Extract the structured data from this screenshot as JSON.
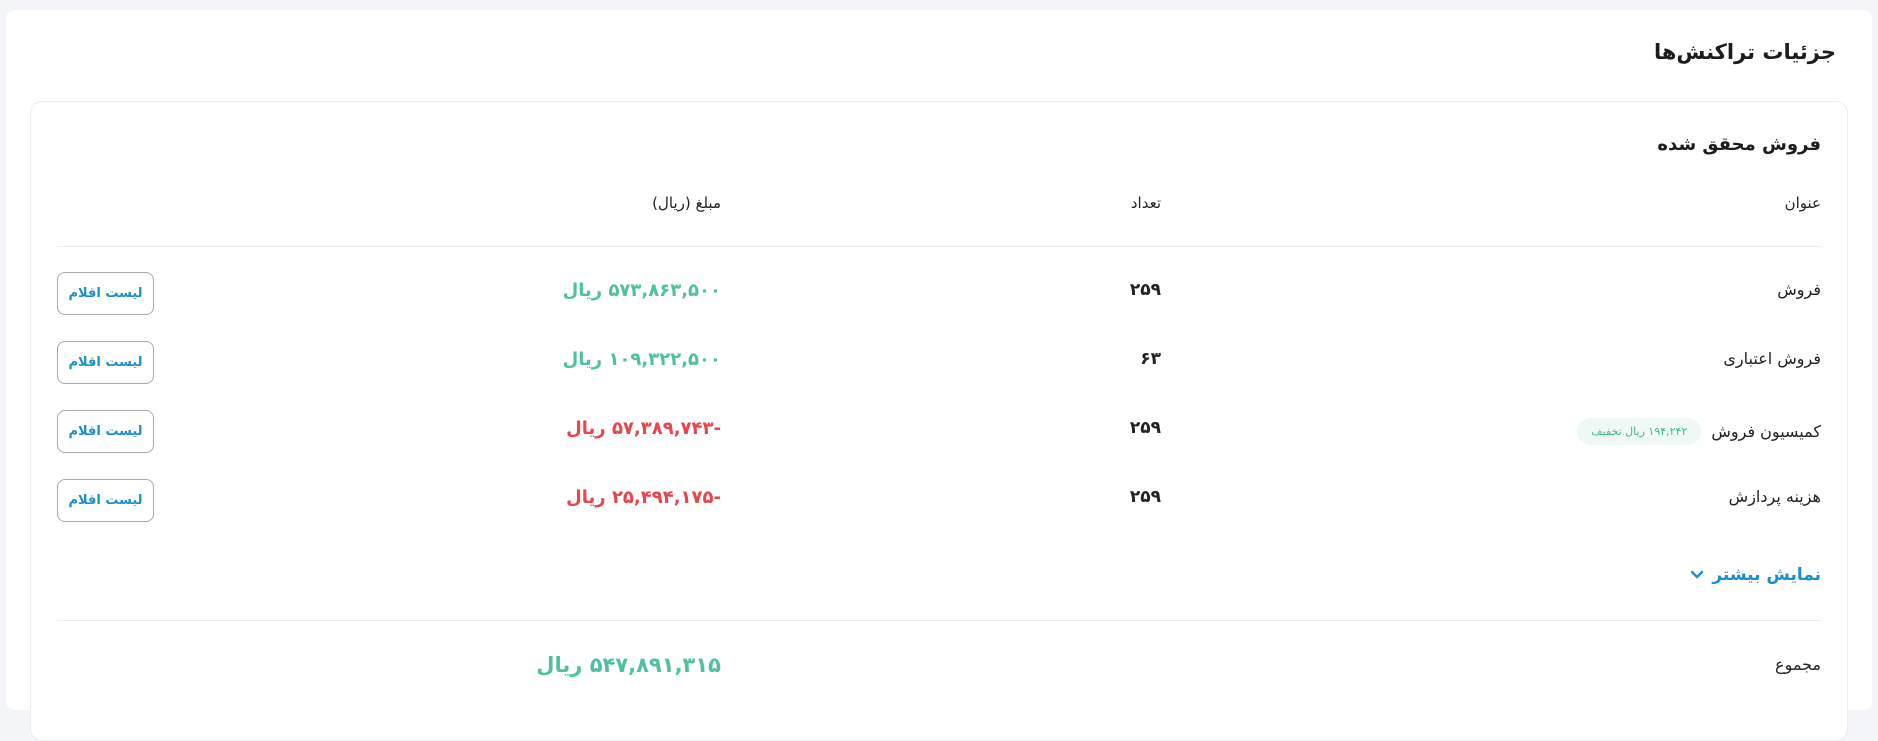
{
  "page": {
    "title": "جزئیات تراکنش‌ها"
  },
  "section": {
    "title": "فروش محقق شده"
  },
  "columns": {
    "title": "عنوان",
    "count": "تعداد",
    "amount": "مبلغ (ریال)"
  },
  "rows": [
    {
      "title": "فروش",
      "badge": "",
      "count": "۲۵۹",
      "amount": "۵۷۳,۸۶۳,۵۰۰ ریال",
      "sign": "positive",
      "button": "لیست اقلام"
    },
    {
      "title": "فروش اعتباری",
      "badge": "",
      "count": "۶۳",
      "amount": "۱۰۹,۳۲۲,۵۰۰ ریال",
      "sign": "positive",
      "button": "لیست اقلام"
    },
    {
      "title": "کمیسیون فروش",
      "badge": "۱۹۴,۲۴۲ ریال تخفیف",
      "count": "۲۵۹",
      "amount": "-۵۷,۳۸۹,۷۴۳ ریال",
      "sign": "negative",
      "button": "لیست اقلام"
    },
    {
      "title": "هزینه پردازش",
      "badge": "",
      "count": "۲۵۹",
      "amount": "-۲۵,۴۹۴,۱۷۵ ریال",
      "sign": "negative",
      "button": "لیست اقلام"
    }
  ],
  "show_more": {
    "label": "نمایش بیشتر",
    "icon": "chevron-down-icon"
  },
  "total": {
    "label": "مجموع",
    "amount": "۵۴۷,۸۹۱,۳۱۵ ریال"
  },
  "colors": {
    "positive": "#50c19f",
    "negative": "#e8454c",
    "accent": "#1b8fc9",
    "badge_bg": "#eef8f4"
  }
}
